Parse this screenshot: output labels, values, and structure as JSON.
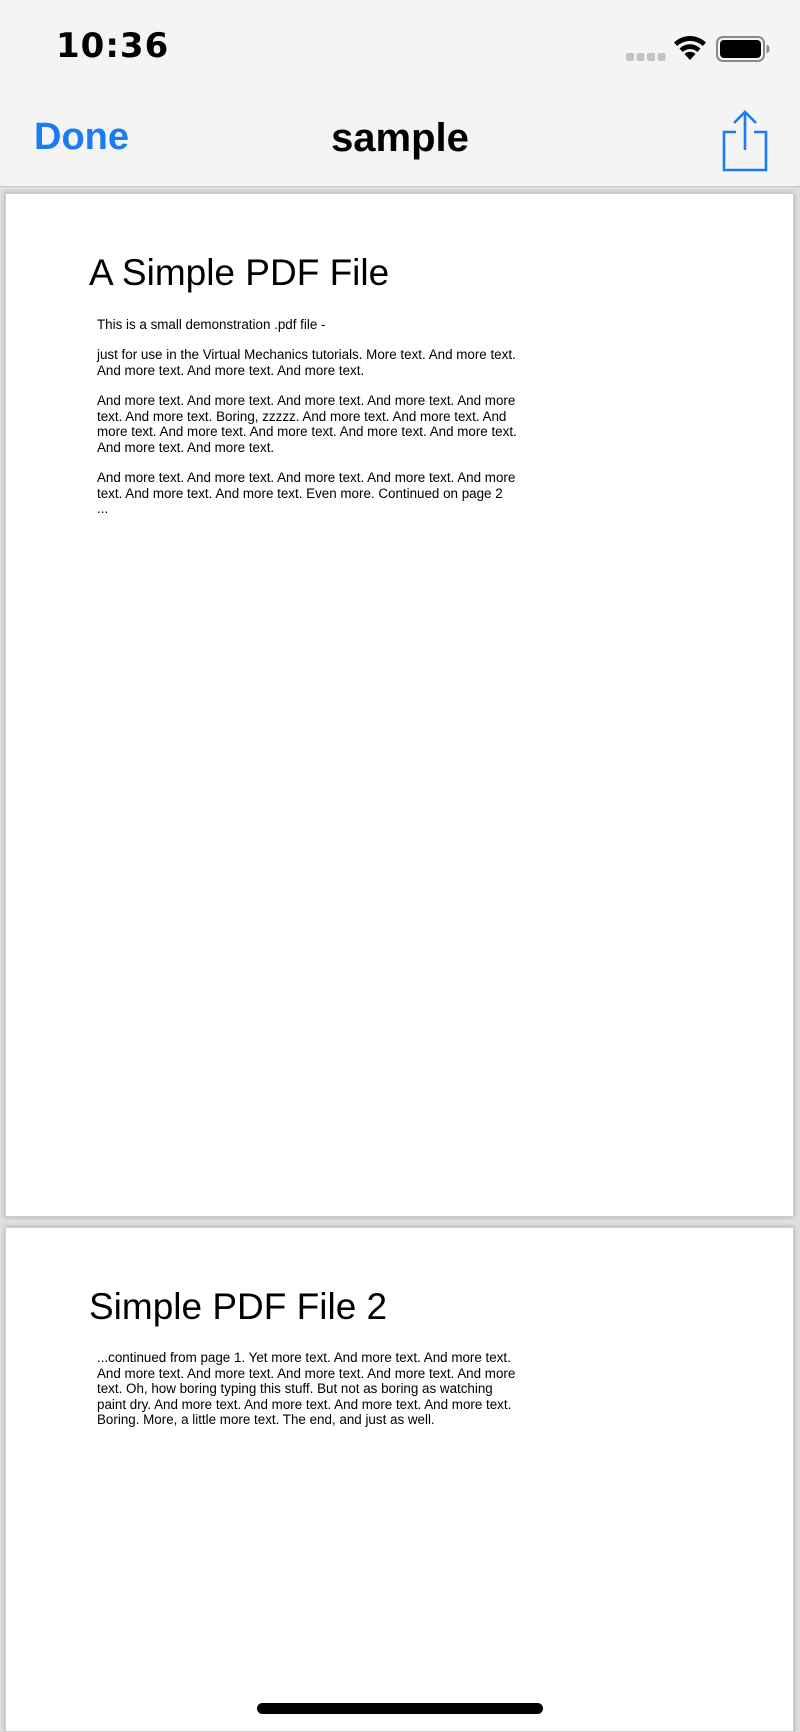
{
  "status_bar": {
    "time": "10:36",
    "icons": [
      "signal-dots-icon",
      "wifi-icon",
      "battery-icon"
    ]
  },
  "nav": {
    "done_label": "Done",
    "title": "sample",
    "share_icon": "share-icon",
    "accent_color": "#1a7cf0"
  },
  "pages": [
    {
      "heading": "A Simple PDF File",
      "paragraphs": [
        "This is a small demonstration .pdf file -",
        "just for use in the Virtual Mechanics tutorials. More text. And more text. And more text. And more text. And more text.",
        "And more text. And more text. And more text. And more text. And more text. And more text. Boring, zzzzz. And more text. And more text. And more text. And more text. And more text. And more text. And more text. And more text. And more text.",
        "And more text. And more text. And more text. And more text. And more text. And more text. And more text. Even more. Continued on page 2 ..."
      ]
    },
    {
      "heading": "Simple PDF File 2",
      "paragraphs": [
        "...continued from page 1. Yet more text. And more text. And more text. And more text. And more text. And more text. And more text. And more text. Oh, how boring typing this stuff. But not as boring as watching paint dry. And more text. And more text. And more text. And more text. Boring.  More, a little more text. The end, and just as well."
      ]
    }
  ]
}
